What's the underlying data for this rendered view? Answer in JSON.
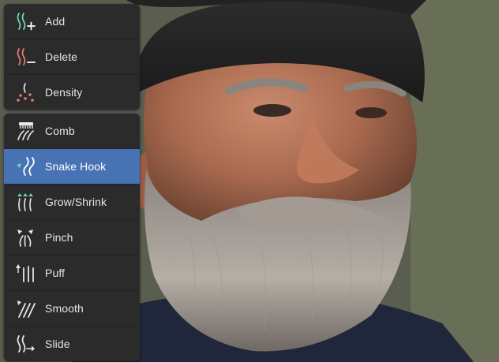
{
  "toolbar": {
    "groups": [
      {
        "tools": [
          {
            "label": "Add",
            "icon": "curves-add-icon"
          },
          {
            "label": "Delete",
            "icon": "curves-delete-icon"
          },
          {
            "label": "Density",
            "icon": "curves-density-icon"
          }
        ]
      },
      {
        "tools": [
          {
            "label": "Comb",
            "icon": "comb-icon"
          },
          {
            "label": "Snake Hook",
            "icon": "snake-hook-icon",
            "active": true
          },
          {
            "label": "Grow/Shrink",
            "icon": "grow-shrink-icon"
          },
          {
            "label": "Pinch",
            "icon": "pinch-icon"
          },
          {
            "label": "Puff",
            "icon": "puff-icon"
          },
          {
            "label": "Smooth",
            "icon": "smooth-icon"
          },
          {
            "label": "Slide",
            "icon": "slide-icon"
          }
        ]
      }
    ]
  },
  "colors": {
    "panel_bg": "#2b2b2b",
    "active_bg": "#4772b3",
    "text": "#e6e6e6",
    "icon_green": "#6fd6b2",
    "icon_red": "#e07b73",
    "icon_white": "#e8e8e8"
  }
}
